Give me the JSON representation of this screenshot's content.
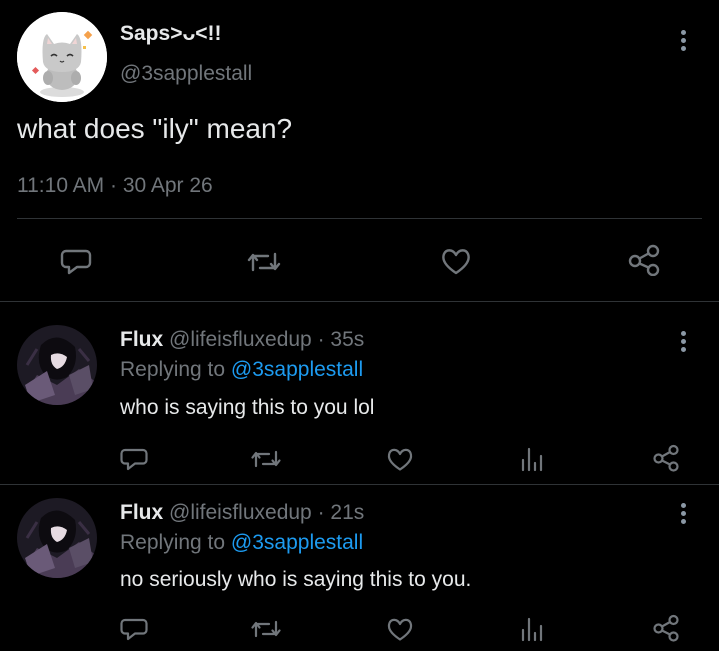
{
  "main_tweet": {
    "display_name": "Saps>ᴗ<!!",
    "handle": "@3sapplestall",
    "text": "what does \"ily\" mean?",
    "timestamp": "11:10 AM · 30 Apr 26",
    "actions": [
      "reply-icon",
      "retweet-icon",
      "like-icon",
      "share-icon"
    ]
  },
  "replies": [
    {
      "display_name": "Flux",
      "handle": "@lifeisfluxedup",
      "time": "· 35s",
      "replying_prefix": "Replying to",
      "replying_to": "@3sapplestall",
      "text": "who is saying this to you lol",
      "actions": [
        "reply-icon",
        "retweet-icon",
        "like-icon",
        "analytics-icon",
        "share-icon"
      ]
    },
    {
      "display_name": "Flux",
      "handle": "@lifeisfluxedup",
      "time": "· 21s",
      "replying_prefix": "Replying to",
      "replying_to": "@3sapplestall",
      "text": "no seriously who is saying this to you.",
      "actions": [
        "reply-icon",
        "retweet-icon",
        "like-icon",
        "analytics-icon",
        "share-icon"
      ]
    }
  ],
  "colors": {
    "background": "#000000",
    "text": "#e7e9ea",
    "muted": "#71767b",
    "link": "#1d9bf0"
  }
}
